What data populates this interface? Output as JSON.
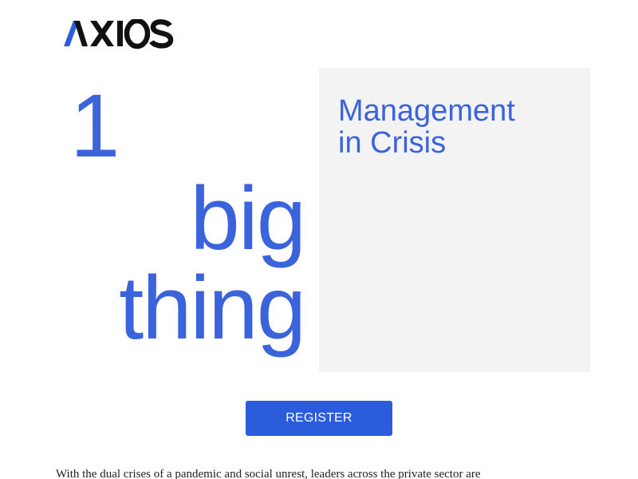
{
  "brand": {
    "logo_text": "AXIOS",
    "logo_color": "#111111",
    "logo_accent": "#2b5cdc"
  },
  "hero": {
    "number": "1",
    "word_1": "big",
    "word_2": "thing",
    "color": "#3b64dc"
  },
  "panel": {
    "title_line_1": "Management",
    "title_line_2": "in Crisis",
    "background": "#f3f3f3"
  },
  "cta": {
    "register_label": "REGISTER",
    "color": "#2b5cdc"
  },
  "body": {
    "intro": "With the dual crises of a pandemic and social unrest, leaders across the private sector are"
  }
}
